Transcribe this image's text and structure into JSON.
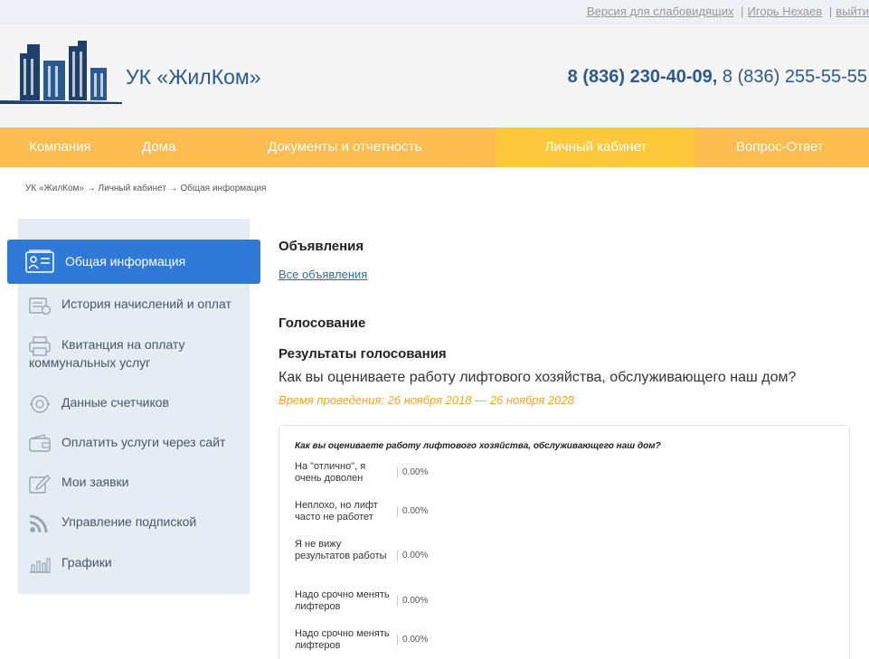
{
  "topbar": {
    "accessibility": "Версия для слабовидящих",
    "user": "Игорь Нехаев",
    "logout": "выйти",
    "separator": "|"
  },
  "header": {
    "brand": "УК «ЖилКом»",
    "phone_primary": "8 (836) 230-40-09,",
    "phone_secondary": "8 (836) 255-55-55"
  },
  "nav": {
    "items": [
      "Компания",
      "Дома",
      "Документы и отчетность",
      "Личный кабинет",
      "Вопрос-Ответ"
    ]
  },
  "breadcrumb": "УК «ЖилКом» → Личный кабинет → Общая информация",
  "sidebar": {
    "items": [
      {
        "label": "Общая информация",
        "icon": "id-card-icon"
      },
      {
        "label": "История начислений и оплат",
        "icon": "history-icon"
      },
      {
        "label": "Квитанция на оплату",
        "label2": "коммунальных услуг",
        "icon": "printer-icon"
      },
      {
        "label": "Данные счетчиков",
        "icon": "meter-icon"
      },
      {
        "label": "Оплатить услуги через сайт",
        "icon": "wallet-icon"
      },
      {
        "label": "Мои заявки",
        "icon": "edit-icon"
      },
      {
        "label": "Управление подпиской",
        "icon": "rss-icon"
      },
      {
        "label": "Графики",
        "icon": "chart-icon"
      }
    ]
  },
  "main": {
    "announcements_title": "Объявления",
    "all_announcements": "Все объявления",
    "voting_title": "Голосование",
    "results_title": "Результаты голосования",
    "question": "Как вы оцениваете работу лифтового хозяйства, обслуживающего наш дом?",
    "period": "Время проведения: 26 ноября 2018 — 26 ноября 2028"
  },
  "poll": {
    "question": "Как вы оцениваете работу лифтового хозяйства, обслуживающего наш дом?",
    "options": [
      {
        "label": "На \"отлично\", я очень доволен",
        "value": "0.00%"
      },
      {
        "label": "Неплохо, но лифт часто не работет",
        "value": "0.00%"
      },
      {
        "label": "Я не вижу результатов работы",
        "value": "0.00%"
      },
      {
        "label": "Надо срочно менять лифтеров",
        "value": "0.00%"
      },
      {
        "label": "Надо срочно менять лифтеров",
        "value": "0.00%"
      }
    ]
  },
  "colors": {
    "brand_blue": "#2d5a8e",
    "nav_orange": "#fdbc4f",
    "active_blue": "#2f7ad6",
    "period_orange": "#f5a623"
  }
}
